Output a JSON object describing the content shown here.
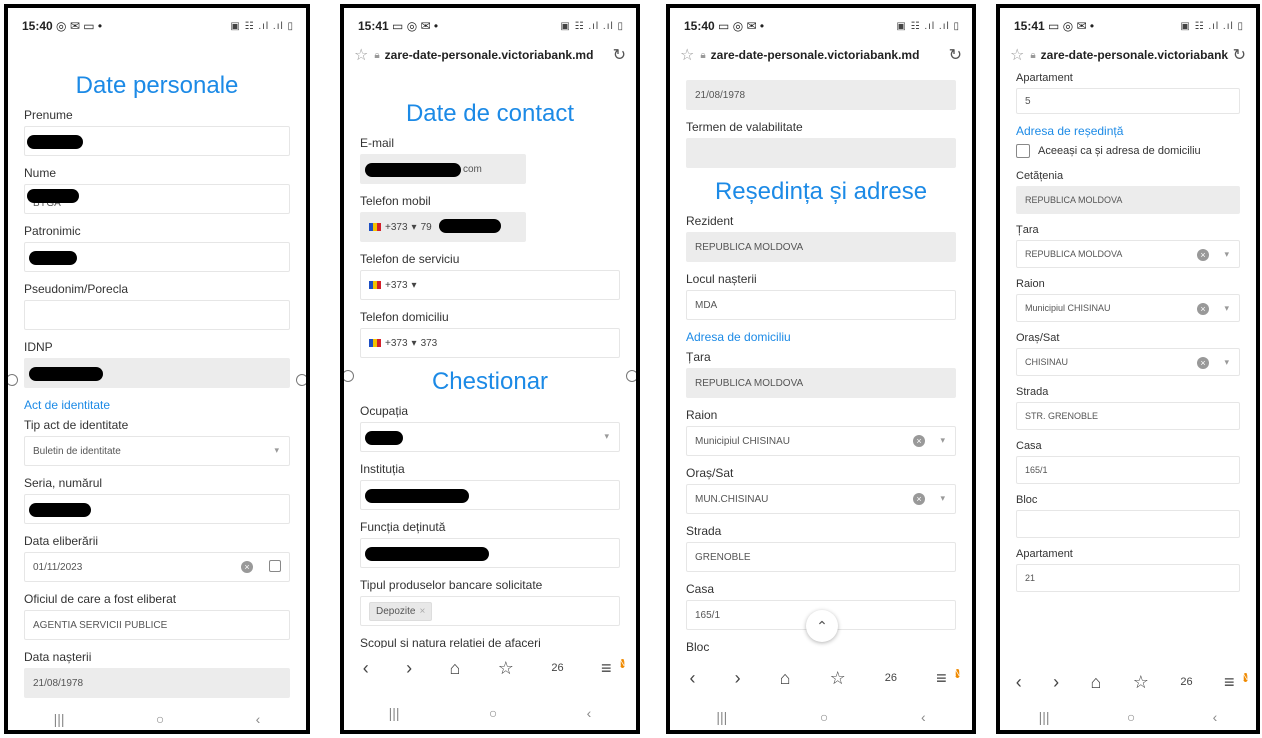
{
  "screens": [
    {
      "status": {
        "time": "15:40",
        "icons": "◎ ✉ ▭ •",
        "right": "▣ ☷ .ıl .ıl ▯"
      },
      "title": "Date personale",
      "labels": {
        "prenume": "Prenume",
        "nume": "Nume",
        "nume_value": "BYGA",
        "patronimic": "Patronimic",
        "pseudonim": "Pseudonim/Porecla",
        "idnp": "IDNP",
        "section_act": "Act de identitate",
        "tip_act": "Tip act de identitate",
        "tip_act_value": "Buletin de identitate",
        "seria": "Seria, numărul",
        "data_elib": "Data eliberării",
        "data_elib_value": "01/11/2023",
        "oficiul": "Oficiul de care a fost eliberat",
        "oficiul_value": "AGENTIA SERVICII PUBLICE",
        "data_nasterii": "Data nașterii",
        "data_nasterii_value": "21/08/1978"
      },
      "nav": {
        "recents": "|||",
        "home": "○",
        "back": "‹"
      }
    },
    {
      "status": {
        "time": "15:41",
        "icons": "▭ ◎ ✉ •",
        "right": "▣ ☷ .ıl .ıl ▯"
      },
      "url": "zare-date-personale.victoriabank.md",
      "title": "Date de contact",
      "labels": {
        "email": "E-mail",
        "email_suffix": "com",
        "mobil": "Telefon mobil",
        "mobil_prefix": "+373",
        "mobil_value": "79",
        "serviciu": "Telefon de serviciu",
        "serviciu_prefix": "+373",
        "domiciliu": "Telefon domiciliu",
        "domiciliu_prefix": "+373",
        "domiciliu_value": "373",
        "chestionar": "Chestionar",
        "ocupatia": "Ocupația",
        "institutia": "Instituția",
        "functia": "Funcția deținută",
        "tipul": "Tipul produselor bancare solicitate",
        "chip": "Depozite",
        "scopul": "Scopul si natura relatiei de afaceri"
      },
      "toolbar": {
        "back": "‹",
        "forward": "›",
        "home": "⌂",
        "bookmarks": "☆",
        "tabs": "26",
        "menu": "≡",
        "badge": "N"
      },
      "nav": {
        "recents": "|||",
        "home": "○",
        "back": "‹"
      }
    },
    {
      "status": {
        "time": "15:40",
        "icons": "▭ ◎ ✉ •",
        "right": "▣ ☷ .ıl .ıl ▯"
      },
      "url": "zare-date-personale.victoriabank.md",
      "labels": {
        "date_top": "21/08/1978",
        "termen": "Termen de valabilitate",
        "title": "Reședința și adrese",
        "rezident": "Rezident",
        "rezident_value": "REPUBLICA MOLDOVA",
        "locul": "Locul nașterii",
        "locul_value": "MDA",
        "section": "Adresa de domiciliu",
        "tara": "Țara",
        "tara_value": "REPUBLICA MOLDOVA",
        "raion": "Raion",
        "raion_value": "Municipiul CHISINAU",
        "oras": "Oraș/Sat",
        "oras_value": "MUN.CHISINAU",
        "strada": "Strada",
        "strada_value": "GRENOBLE",
        "casa": "Casa",
        "casa_value": "165/1",
        "bloc": "Bloc"
      },
      "toolbar": {
        "back": "‹",
        "forward": "›",
        "home": "⌂",
        "bookmarks": "☆",
        "tabs": "26",
        "menu": "≡",
        "badge": "N"
      },
      "nav": {
        "recents": "|||",
        "home": "○",
        "back": "‹"
      }
    },
    {
      "status": {
        "time": "15:41",
        "icons": "▭ ◎ ✉ •",
        "right": "▣ ☷ .ıl .ıl ▯"
      },
      "url": "zare-date-personale.victoriabank.md",
      "labels": {
        "apartament_top": "Apartament",
        "apartament_top_value": "5",
        "section": "Adresa de reședință",
        "checkbox": "Aceeași ca și adresa de domiciliu",
        "cetatenia": "Cetățenia",
        "cetatenia_value": "REPUBLICA MOLDOVA",
        "tara": "Țara",
        "tara_value": "REPUBLICA MOLDOVA",
        "raion": "Raion",
        "raion_value": "Municipiul CHISINAU",
        "oras": "Oraș/Sat",
        "oras_value": "CHISINAU",
        "strada": "Strada",
        "strada_value": "STR. GRENOBLE",
        "casa": "Casa",
        "casa_value": "165/1",
        "bloc": "Bloc",
        "apartament": "Apartament",
        "apartament_value": "21"
      },
      "toolbar": {
        "back": "‹",
        "forward": "›",
        "home": "⌂",
        "bookmarks": "☆",
        "tabs": "26",
        "menu": "≡",
        "badge": "N"
      },
      "nav": {
        "recents": "|||",
        "home": "○",
        "back": "‹"
      }
    }
  ]
}
